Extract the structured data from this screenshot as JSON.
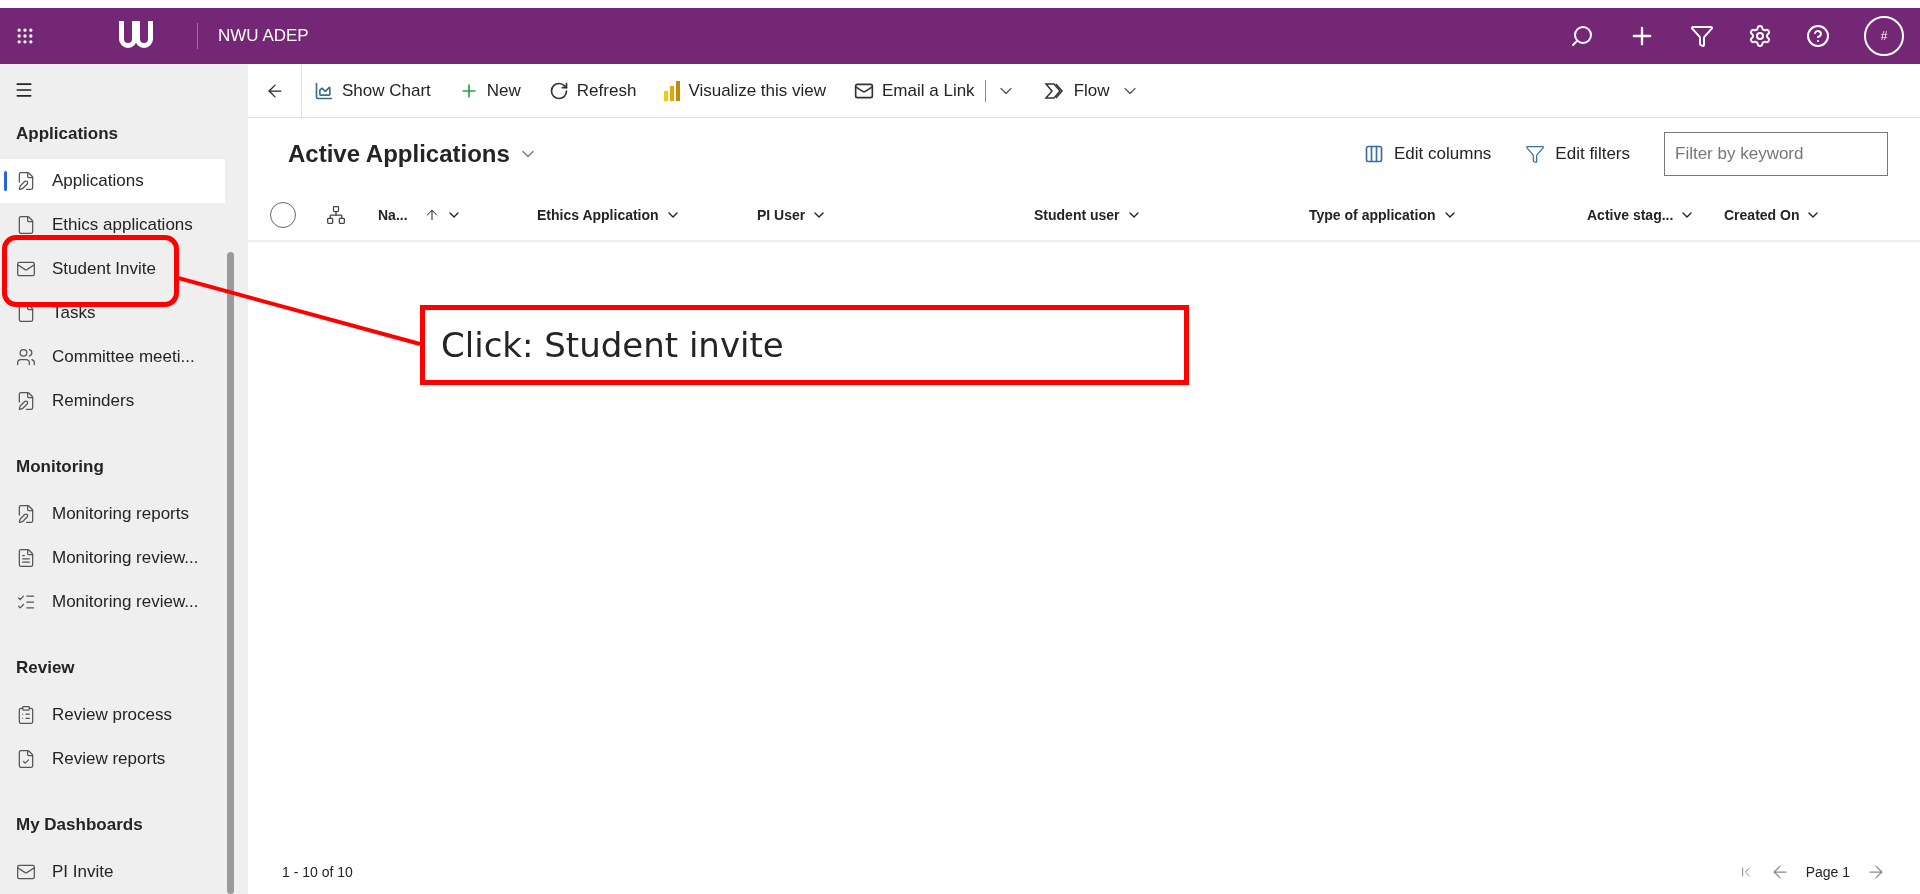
{
  "app_bar": {
    "title": "NWU ADEP",
    "avatar": "#"
  },
  "command_bar": [
    {
      "label": "Show Chart",
      "kind": "chart"
    },
    {
      "label": "New",
      "kind": "new"
    },
    {
      "label": "Refresh",
      "kind": "refresh"
    },
    {
      "label": "Visualize this view",
      "kind": "visualize"
    },
    {
      "label": "Email a Link",
      "kind": "email"
    },
    {
      "label": "Flow",
      "kind": "flow"
    }
  ],
  "sidebar": {
    "sections": [
      {
        "title": "Applications",
        "items": [
          {
            "label": "Applications",
            "selected": true
          },
          {
            "label": "Ethics applications",
            "selected": false
          },
          {
            "label": "Student Invite",
            "selected": false
          },
          {
            "label": "Tasks",
            "selected": false
          },
          {
            "label": "Committee meeti...",
            "selected": false
          },
          {
            "label": "Reminders",
            "selected": false
          }
        ]
      },
      {
        "title": "Monitoring",
        "items": [
          {
            "label": "Monitoring reports",
            "selected": false
          },
          {
            "label": "Monitoring review...",
            "selected": false
          },
          {
            "label": "Monitoring review...",
            "selected": false
          }
        ]
      },
      {
        "title": "Review",
        "items": [
          {
            "label": "Review process",
            "selected": false
          },
          {
            "label": "Review reports",
            "selected": false
          }
        ]
      },
      {
        "title": "My Dashboards",
        "items": [
          {
            "label": "PI Invite",
            "selected": false
          }
        ]
      }
    ]
  },
  "view": {
    "title": "Active Applications",
    "actions": [
      "Edit columns",
      "Edit filters"
    ],
    "filter": {
      "placeholder": "Filter by keyword"
    }
  },
  "select_all": {
    "checked": false
  },
  "columns": [
    {
      "label": "Na...",
      "sorted": true
    },
    {
      "label": "Ethics Application",
      "sorted": false
    },
    {
      "label": "PI User",
      "sorted": false
    },
    {
      "label": "Student user",
      "sorted": false
    },
    {
      "label": "Type of application",
      "sorted": false
    },
    {
      "label": "Active stag...",
      "sorted": false
    },
    {
      "label": "Created On",
      "sorted": false
    }
  ],
  "footer": {
    "count": "1 - 10 of 10",
    "page": "Page 1"
  },
  "annotation": {
    "text": "Click: Student invite"
  }
}
